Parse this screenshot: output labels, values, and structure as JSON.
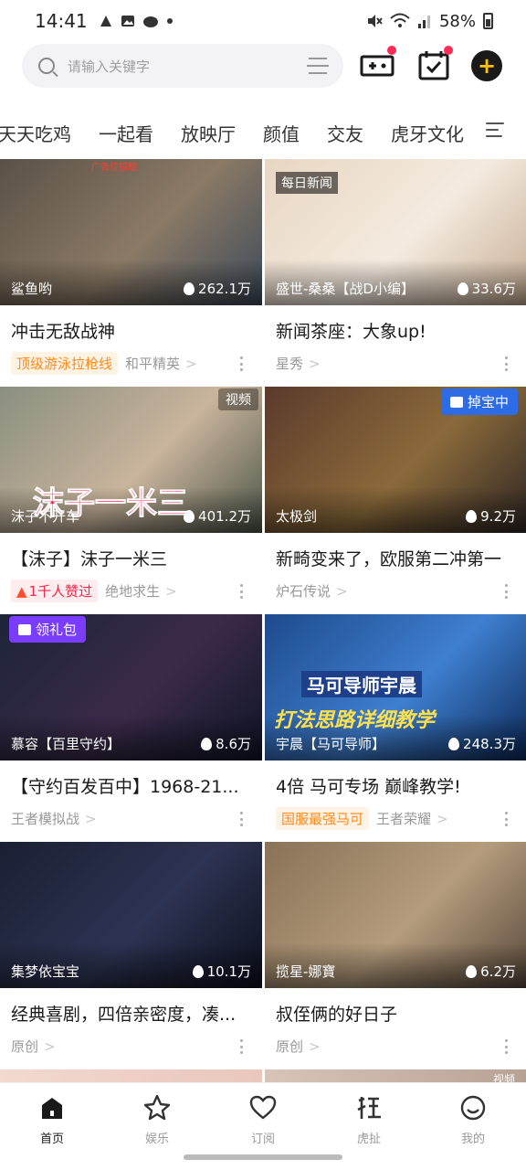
{
  "status_bar": {
    "time": "14:41",
    "battery": "58%"
  },
  "search": {
    "placeholder": "请输入关键字"
  },
  "categories": [
    "天天吃鸡",
    "一起看",
    "放映厅",
    "颜值",
    "交友",
    "虎牙文化"
  ],
  "cards": [
    {
      "anchor": "鲨鱼哟",
      "heat": "262.1万",
      "title": "冲击无敌战神",
      "chip": "顶级游泳拉枪线",
      "chip_style": "orange",
      "game": "和平精英",
      "overlay_text": "广告位招租",
      "colors": [
        "#5a5148",
        "#8b7a66",
        "#3c4a5a"
      ]
    },
    {
      "anchor": "盛世-桑桑【战D小编】",
      "heat": "33.6万",
      "title": "新闻茶座：大象up!",
      "chip": "",
      "game": "星秀",
      "overlay_text": "每日新闻",
      "colors": [
        "#e8d6c2",
        "#f4ebe0",
        "#c6ad92"
      ]
    },
    {
      "anchor": "沫子不开车",
      "heat": "401.2万",
      "title": "【沫子】沫子一米三",
      "chip": "1千人赞过",
      "chip_style": "red",
      "game": "绝地求生",
      "overlay_text": "沫子一米三",
      "tag": "视频",
      "colors": [
        "#8a8f80",
        "#c9b49c",
        "#4c5548"
      ]
    },
    {
      "anchor": "太极剑",
      "heat": "9.2万",
      "title": "新畸变来了，欧服第二冲第一",
      "chip": "",
      "game": "炉石传说",
      "badge": "掉宝中",
      "colors": [
        "#5b3a2c",
        "#8a6a3a",
        "#2f2624"
      ]
    },
    {
      "anchor": "慕容【百里守约】",
      "heat": "8.6万",
      "title": "【守约百发百中】1968-21...",
      "chip": "",
      "game": "王者模拟战",
      "badge": "领礼包",
      "colors": [
        "#1c2438",
        "#3b2a4a",
        "#0e1526"
      ]
    },
    {
      "anchor": "宇晨【马可导师】",
      "heat": "248.3万",
      "title": "4倍 马可专场 巅峰教学!",
      "chip": "国服最强马可",
      "chip_style": "orange",
      "game": "王者荣耀",
      "overlay_text": "马可导师宇晨",
      "overlay_text2": "打法思路详细教学",
      "colors": [
        "#1e4a8c",
        "#3f7fd0",
        "#0c2a58"
      ]
    },
    {
      "anchor": "集梦依宝宝",
      "heat": "10.1万",
      "title": "经典喜剧，四倍亲密度，凑...",
      "chip": "",
      "game": "原创",
      "colors": [
        "#1a1f33",
        "#2d3352",
        "#0c0f1c"
      ]
    },
    {
      "anchor": "揽星-娜寶",
      "heat": "6.2万",
      "title": "叔侄俩的好日子",
      "chip": "",
      "game": "原创",
      "colors": [
        "#8a7258",
        "#b59c7d",
        "#5a4a3c"
      ]
    }
  ],
  "peek_tag": "视频",
  "bottom_nav": [
    {
      "label": "首页",
      "icon": "home-icon",
      "active": true
    },
    {
      "label": "娱乐",
      "icon": "star-icon",
      "active": false
    },
    {
      "label": "订阅",
      "icon": "heart-icon",
      "active": false
    },
    {
      "label": "虎扯",
      "icon": "huche-icon",
      "active": false
    },
    {
      "label": "我的",
      "icon": "profile-icon",
      "active": false
    }
  ],
  "accent": "#ffc400",
  "notify_red": "#ff2a55"
}
